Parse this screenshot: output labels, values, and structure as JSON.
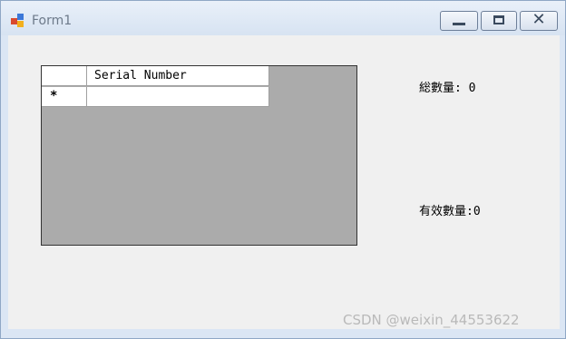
{
  "window": {
    "title": "Form1",
    "icon": "winforms-app-icon",
    "controls": [
      "minimize-icon",
      "maximize-icon",
      "close-icon"
    ]
  },
  "grid": {
    "columns": [
      "Serial Number"
    ],
    "new_row_marker": "*",
    "new_row_value": "",
    "background_color": "#ababab"
  },
  "labels": {
    "total": "総數量: 0",
    "valid": "有效數量:0"
  },
  "watermark": "CSDN @weixin_44553622"
}
